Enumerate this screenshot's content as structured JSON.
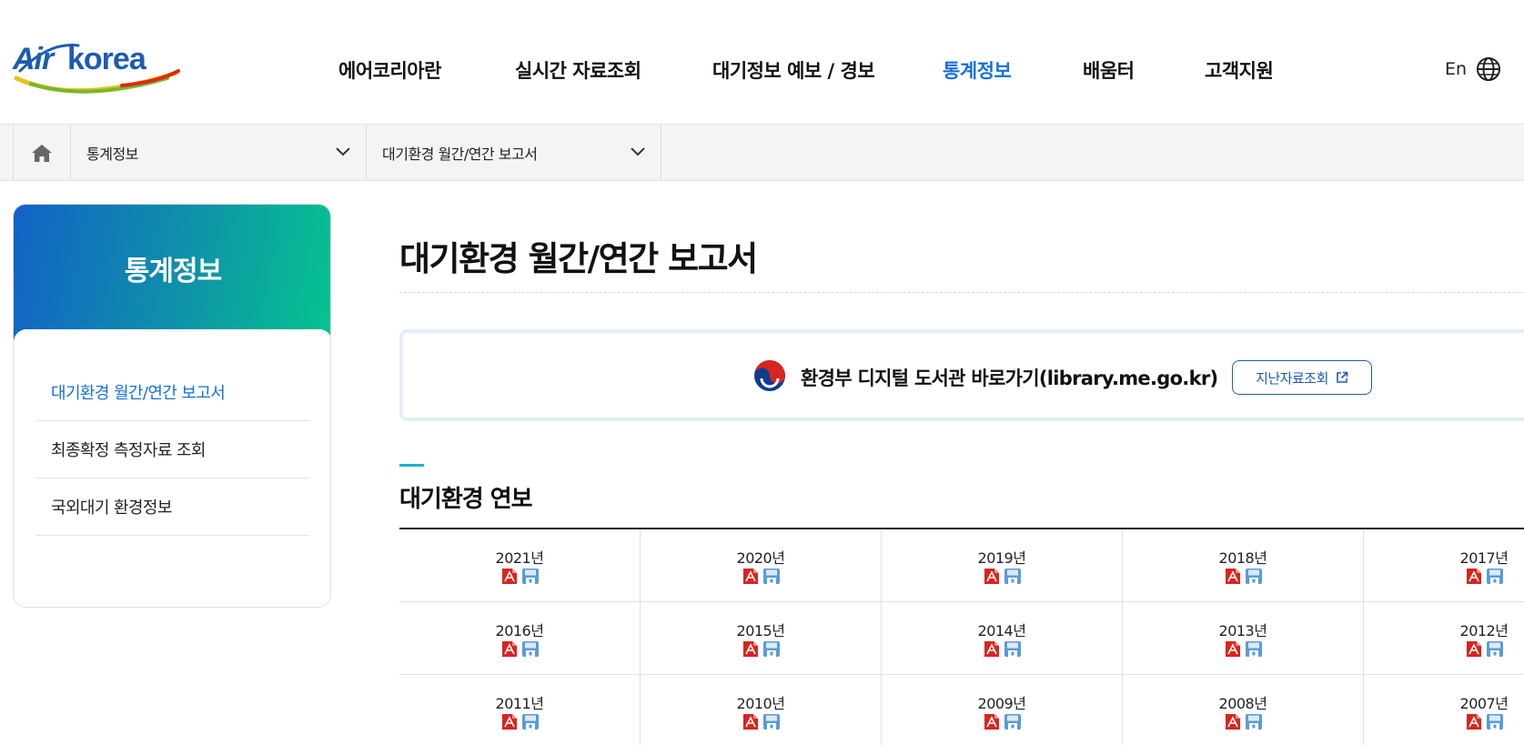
{
  "brand": {
    "logo_left": "Air",
    "logo_right": "korea"
  },
  "gnb": {
    "items": [
      {
        "label": "에어코리아란"
      },
      {
        "label": "실시간 자료조회"
      },
      {
        "label": "대기정보 예보 / 경보"
      },
      {
        "label": "통계정보",
        "active": true
      },
      {
        "label": "배움터"
      },
      {
        "label": "고객지원"
      }
    ],
    "lang_label": "En",
    "lang_icon": "globe-icon"
  },
  "breadcrumb": {
    "home_icon": "home-icon",
    "level1": "통계정보",
    "level2": "대기환경 월간/연간 보고서"
  },
  "sidebar": {
    "title": "통계정보",
    "items": [
      {
        "label": "대기환경 월간/연간 보고서",
        "active": true
      },
      {
        "label": "최종확정 측정자료 조회"
      },
      {
        "label": "국외대기 환경정보"
      }
    ]
  },
  "main": {
    "title": "대기환경 월간/연간 보고서",
    "library": {
      "text": "환경부 디지털 도서관 바로가기(library.me.go.kr)",
      "button_label": "지난자료조회",
      "button_icon": "external-link-icon"
    },
    "section_title": "대기환경 연보",
    "years": [
      [
        "2021년",
        "2020년",
        "2019년",
        "2018년",
        "2017년"
      ],
      [
        "2016년",
        "2015년",
        "2014년",
        "2013년",
        "2012년"
      ],
      [
        "2011년",
        "2010년",
        "2009년",
        "2008년",
        "2007년"
      ]
    ],
    "file_icons": [
      "pdf-icon",
      "save-icon"
    ]
  },
  "colors": {
    "accent": "#1670d8",
    "brand_blue": "#1d5cb0",
    "section_mark": "#19b5c4",
    "gradient_start": "#1262c6",
    "gradient_end": "#05c48f",
    "pdf_red": "#d7261f"
  }
}
